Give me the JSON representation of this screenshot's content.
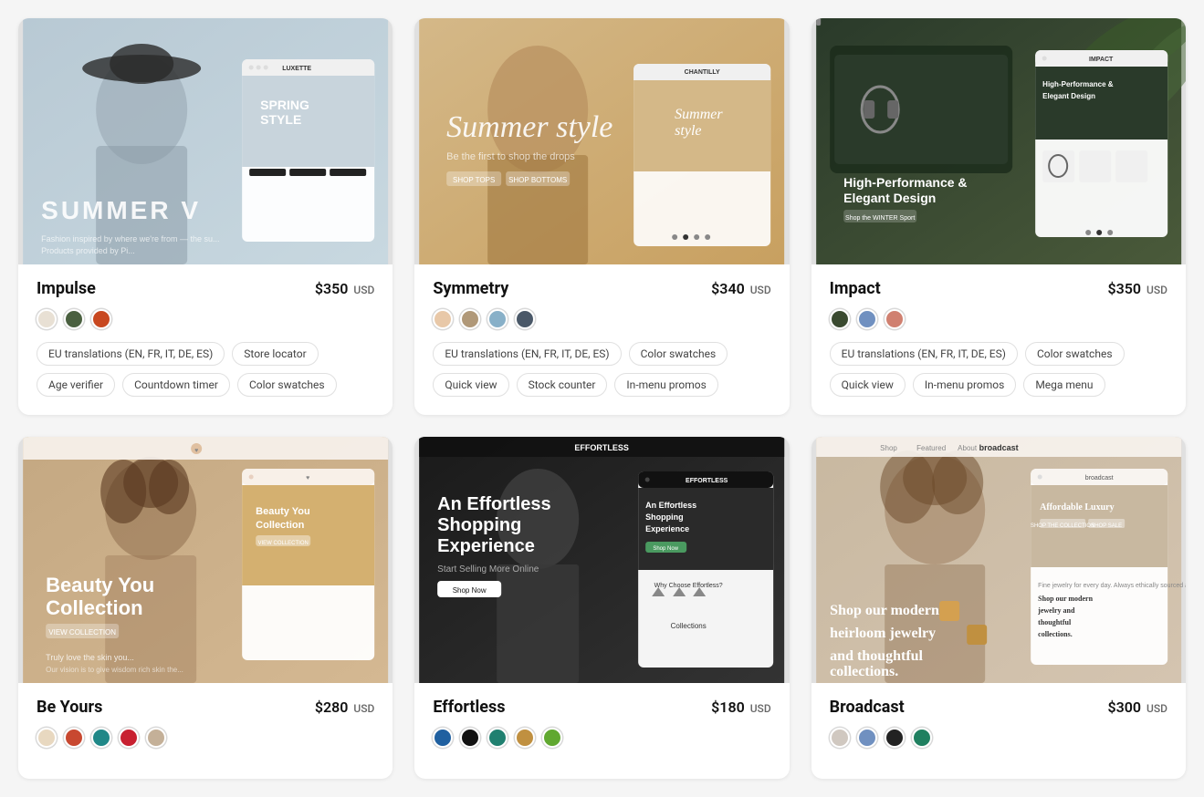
{
  "cards": [
    {
      "id": "impulse",
      "name": "Impulse",
      "price": "$350",
      "currency": "USD",
      "preview_type": "fashion-light",
      "preview_text": "SUMMER V",
      "preview_sub": "Fashion inspired by where we're from",
      "bg_colors": [
        "#b8c9d4",
        "#c8d8e0"
      ],
      "person_color": "#8090a0",
      "swatches": [
        {
          "color": "#e8e0d4",
          "border": true
        },
        {
          "color": "#4a6040"
        },
        {
          "color": "#c84820"
        }
      ],
      "tags": [
        "EU translations (EN, FR, IT, DE, ES)",
        "Store locator",
        "Age verifier",
        "Countdown timer",
        "Color swatches"
      ]
    },
    {
      "id": "symmetry",
      "name": "Symmetry",
      "price": "$340",
      "currency": "USD",
      "preview_type": "fashion-warm",
      "preview_text": "Summer style",
      "preview_sub": "Be the first to shop the drops",
      "bg_colors": [
        "#c8a870",
        "#d4b888"
      ],
      "person_color": "#b09070",
      "swatches": [
        {
          "color": "#e8c8a8"
        },
        {
          "color": "#b09878"
        },
        {
          "color": "#88b0c8"
        },
        {
          "color": "#4a5868"
        }
      ],
      "tags": [
        "EU translations (EN, FR, IT, DE, ES)",
        "Color swatches",
        "Quick view",
        "Stock counter",
        "In-menu promos"
      ]
    },
    {
      "id": "impact",
      "name": "Impact",
      "price": "$350",
      "currency": "USD",
      "preview_type": "tech-dark",
      "preview_text": "High-Performance & Elegant Design",
      "preview_sub": "Shop the WINTER Sport",
      "bg_colors": [
        "#2a3a2a",
        "#4a5a3a"
      ],
      "person_color": "#3a4a3a",
      "swatches": [
        {
          "color": "#3a4a30"
        },
        {
          "color": "#7090c0"
        },
        {
          "color": "#d08070"
        }
      ],
      "tags": [
        "EU translations (EN, FR, IT, DE, ES)",
        "Color swatches",
        "Quick view",
        "In-menu promos",
        "Mega menu"
      ]
    },
    {
      "id": "beyours",
      "name": "Be Yours",
      "price": "$280",
      "currency": "USD",
      "preview_type": "beauty-warm",
      "preview_text": "Beauty You Collection",
      "preview_sub": "Truly love the skin you're in",
      "bg_colors": [
        "#c4a882",
        "#d4b892"
      ],
      "person_color": "#b09070",
      "swatches": [
        {
          "color": "#e8d8c0"
        },
        {
          "color": "#c84830"
        },
        {
          "color": "#208888"
        },
        {
          "color": "#c82030"
        },
        {
          "color": "#c4b098"
        }
      ],
      "tags": []
    },
    {
      "id": "effortless",
      "name": "Effortless",
      "price": "$180",
      "currency": "USD",
      "preview_type": "fashion-dark",
      "preview_text": "An Effortless Shopping Experience",
      "preview_sub": "Start Selling More Online",
      "bg_colors": [
        "#1a1a1a",
        "#333"
      ],
      "person_color": "#444",
      "swatches": [
        {
          "color": "#2060a0"
        },
        {
          "color": "#111111"
        },
        {
          "color": "#208070"
        },
        {
          "color": "#c09040"
        },
        {
          "color": "#60a830"
        }
      ],
      "tags": []
    },
    {
      "id": "broadcast",
      "name": "Broadcast",
      "price": "$300",
      "currency": "USD",
      "preview_type": "jewelry",
      "preview_text": "Shop our modern heirloom jewelry and thoughtful collections.",
      "preview_sub": "Affordable Luxury",
      "bg_colors": [
        "#c8b8a0",
        "#d4c4b0"
      ],
      "person_color": "#b8a890",
      "swatches": [
        {
          "color": "#d0c8c0"
        },
        {
          "color": "#7090c0"
        },
        {
          "color": "#222222"
        },
        {
          "color": "#208060"
        }
      ],
      "tags": []
    }
  ],
  "labels": {
    "usd": "USD",
    "summer_v": "SUMMER V",
    "summer_style": "Summer style",
    "spring_style": "SPRING STYLE",
    "high_performance": "High-Performance &",
    "elegant_design": "Elegant Design",
    "beauty_collection": "Beauty You Collection",
    "effortless_shopping": "An Effortless Shopping Experience",
    "shop_modern": "Shop our modern",
    "heirloom_jewelry": "heirloom jewelry",
    "affordable_luxury": "Affordable Luxury"
  }
}
